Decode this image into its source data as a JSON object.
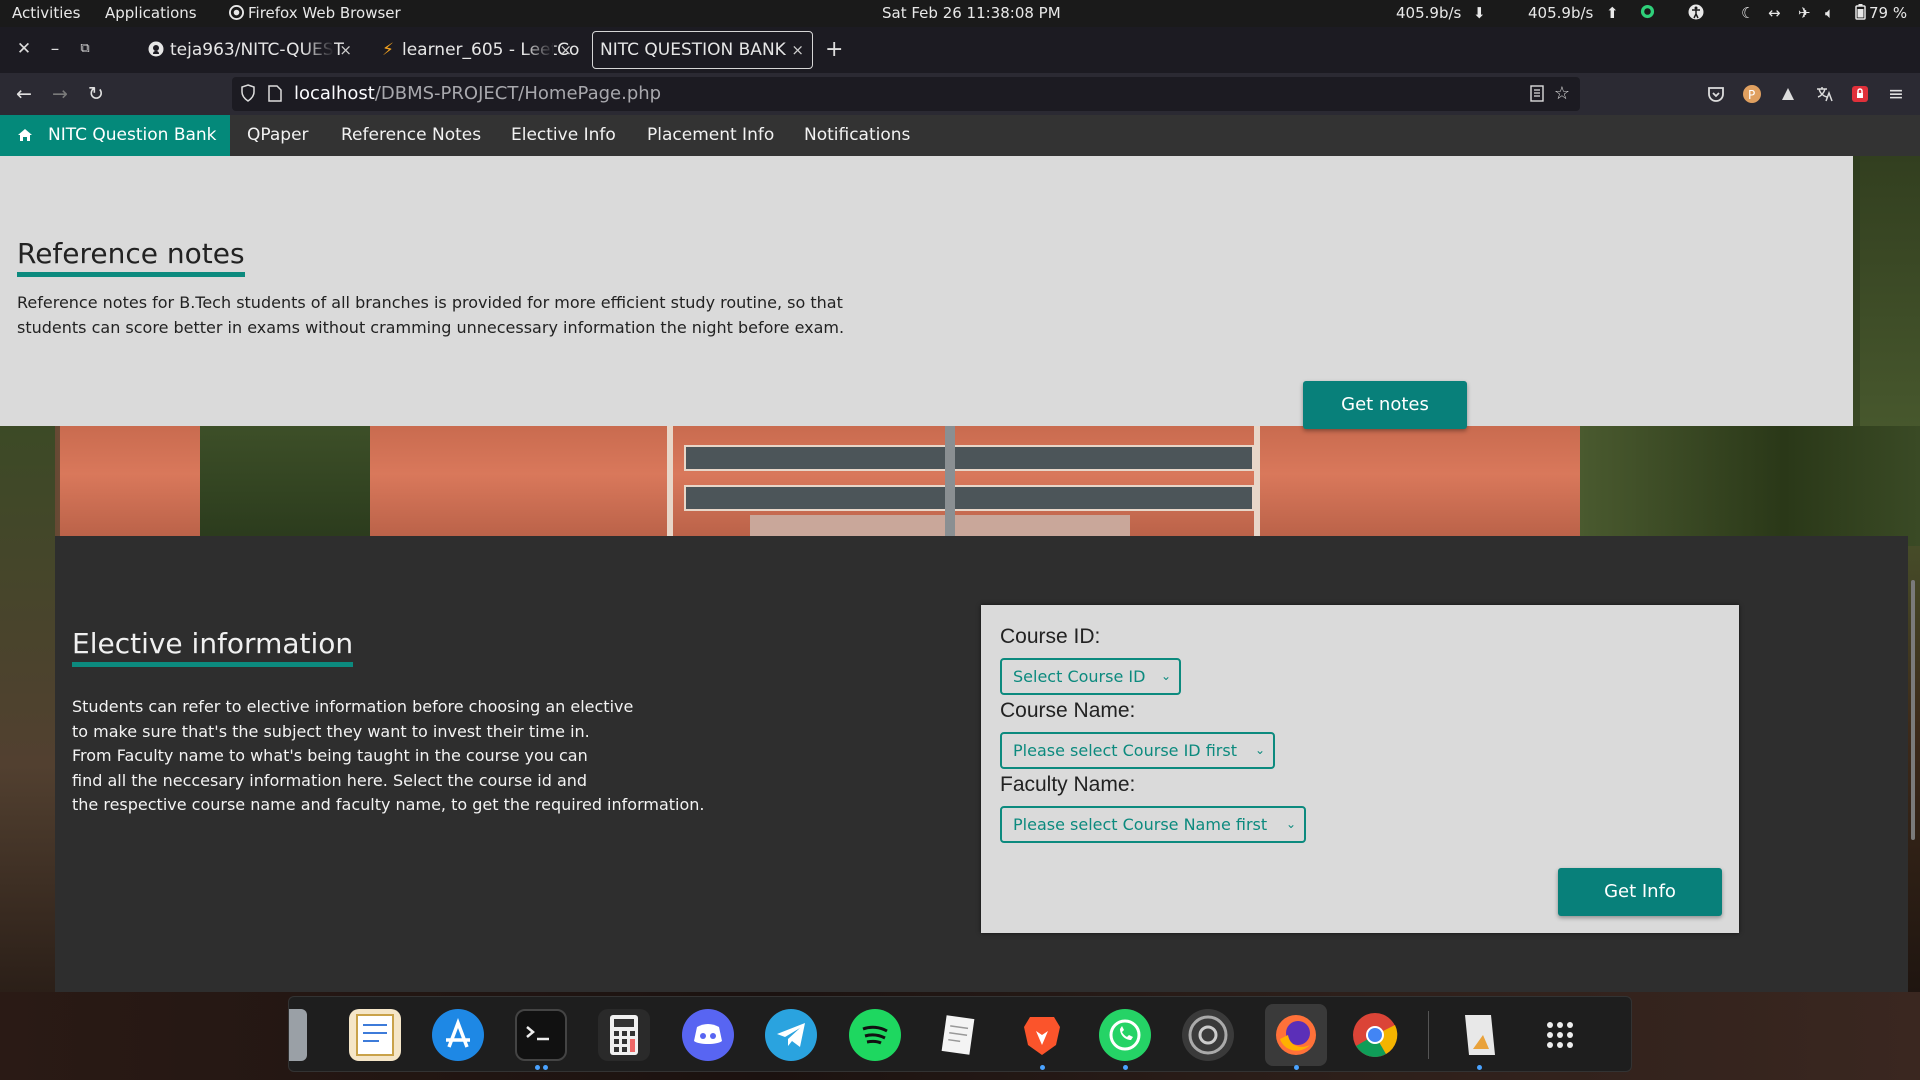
{
  "topbar": {
    "activities": "Activities",
    "applications": "Applications",
    "app_name": "Firefox Web Browser",
    "clock": "Sat Feb 26  11:38:08 PM",
    "net_down": "405.9b/s",
    "net_up": "405.9b/s",
    "battery": "79 %"
  },
  "tabs": [
    {
      "title": "teja963/NITC-QUEST",
      "icon": "github-icon"
    },
    {
      "title": "learner_605 - LeetCo",
      "icon": "leetcode-icon"
    },
    {
      "title": "NITC QUESTION BANK",
      "icon": "",
      "active": true
    }
  ],
  "tab_close": "×",
  "new_tab": "+",
  "urlbar": {
    "host": "localhost",
    "path": "/DBMS-PROJECT/HomePage.php"
  },
  "site_nav": {
    "brand": "NITC Question Bank",
    "links": [
      "QPaper",
      "Reference Notes",
      "Elective Info",
      "Placement Info",
      "Notifications"
    ]
  },
  "reference": {
    "heading": "Reference notes",
    "text_line1": "Reference notes for B.Tech students of all branches is provided for more efficient study routine, so that",
    "text_line2": "students can score better in exams without cramming unnecessary information the night before exam.",
    "button": "Get notes"
  },
  "elective": {
    "heading": "Elective information",
    "lines": [
      "Students can refer to elective information before choosing an elective",
      "to make sure that's the subject they want to invest their time in.",
      "From Faculty name to what's being taught in the course you can",
      "find all the neccesary information here. Select the course id and",
      "the respective course name and faculty name, to get the required information."
    ],
    "form": {
      "course_id_label": "Course ID:",
      "course_id_value": "Select Course ID",
      "course_name_label": "Course Name:",
      "course_name_value": "Please select Course ID first",
      "faculty_label": "Faculty Name:",
      "faculty_value": "Please select Course Name first",
      "submit": "Get Info"
    }
  },
  "colors": {
    "accent": "#0c8a7e",
    "button": "#08807a",
    "panel_light": "#dadada",
    "panel_dark": "#2e2e2e",
    "site_nav": "#333333"
  },
  "dock_apps": [
    "files-icon",
    "text-editor-icon",
    "app-store-icon",
    "terminal-icon",
    "calculator-icon",
    "discord-icon",
    "telegram-icon",
    "spotify-icon",
    "notes-icon",
    "brave-icon",
    "whatsapp-icon",
    "settings-icon",
    "firefox-icon",
    "chrome-icon",
    "image-editor-icon",
    "app-grid-icon"
  ]
}
